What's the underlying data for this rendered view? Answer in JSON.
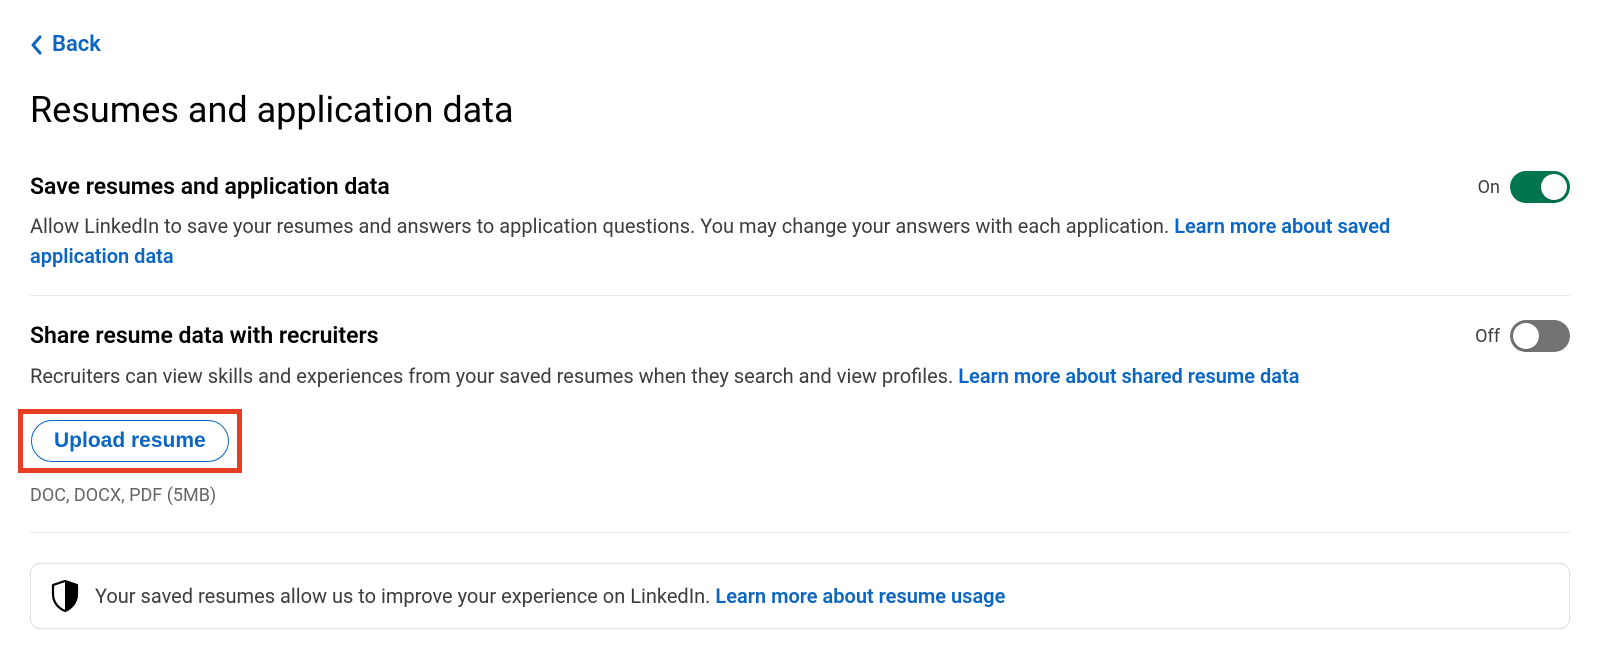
{
  "back": {
    "label": "Back"
  },
  "page_title": "Resumes and application data",
  "sections": {
    "save": {
      "title": "Save resumes and application data",
      "desc": "Allow LinkedIn to save your resumes and answers to application questions. You may change your answers with each application. ",
      "learn_more": "Learn more about saved application data",
      "toggle_state": "On"
    },
    "share": {
      "title": "Share resume data with recruiters",
      "desc": "Recruiters can view skills and experiences from your saved resumes when they search and view profiles. ",
      "learn_more": "Learn more about shared resume data",
      "toggle_state": "Off"
    }
  },
  "upload": {
    "button_label": "Upload resume",
    "file_hint": "DOC, DOCX, PDF (5MB)"
  },
  "info_banner": {
    "text": "Your saved resumes allow us to improve your experience on LinkedIn. ",
    "learn_more": "Learn more about resume usage"
  }
}
